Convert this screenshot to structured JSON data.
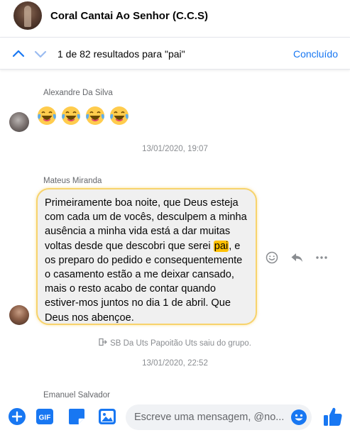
{
  "header": {
    "title": "Coral Cantai Ao Senhor (C.C.S)"
  },
  "search": {
    "result_text": "1 de 82 resultados para \"pai\"",
    "done_label": "Concluído"
  },
  "messages": [
    {
      "sender": "Alexandre Da Silva",
      "emoji_count": 4
    },
    {
      "timestamp": "13/01/2020, 19:07"
    },
    {
      "sender": "Mateus Miranda",
      "text_before": "Primeiramente boa noite, que Deus esteja com cada um de vocês, desculpem a minha ausência a minha vida está a dar muitas voltas desde que descobri que serei ",
      "highlight": "pai",
      "text_after": ", e os preparo do pedido e consequentemente o casamento estão a me deixar cansado, mais o resto acabo de contar quando estiver-mos juntos no dia 1 de abril.  Que Deus nos abençoe."
    },
    {
      "system": "SB Da Uts Papoitão Uts saiu do grupo."
    },
    {
      "timestamp": "13/01/2020, 22:52"
    },
    {
      "sender": "Emanuel Salvador"
    }
  ],
  "composer": {
    "placeholder": "Escreve uma mensagem, @no..."
  },
  "colors": {
    "accent": "#1877f2",
    "highlight": "#ffc000",
    "bubble_border": "#f7d36c",
    "bubble_bg": "#f0f0f0"
  },
  "icons": {
    "nav_up": "chevron-up-icon",
    "nav_down": "chevron-down-icon",
    "react": "smiley-icon",
    "reply": "reply-icon",
    "more": "more-icon",
    "add": "plus-circle-icon",
    "gif": "gif-icon",
    "sticker": "sticker-icon",
    "photo": "image-icon",
    "emoji": "emoji-icon",
    "like": "thumbs-up-icon"
  }
}
